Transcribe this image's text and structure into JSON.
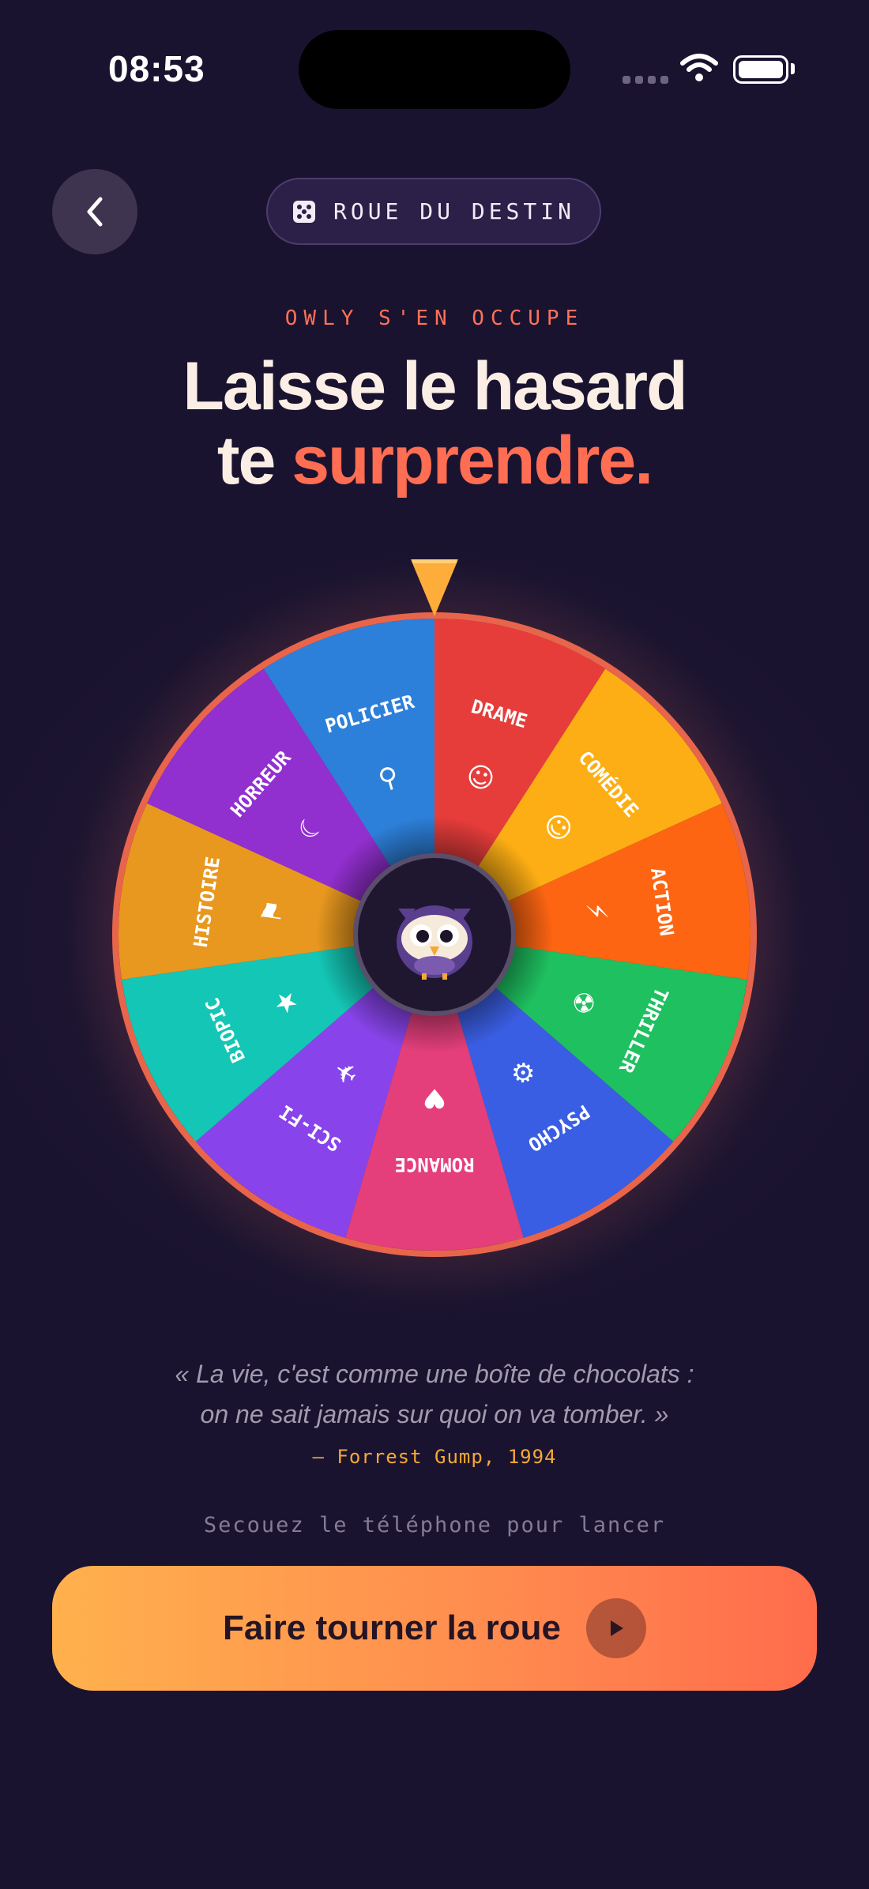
{
  "status": {
    "time": "08:53"
  },
  "header": {
    "badge_label": "ROUE DU DESTIN"
  },
  "hero": {
    "eyebrow": "OWLY S'EN OCCUPE",
    "title_line1": "Laisse le hasard",
    "title_line2_plain": "te ",
    "title_line2_accent": "surprendre."
  },
  "wheel": {
    "pointer_color": "#ffad3a",
    "rim_color": "#e8654c",
    "segments": [
      {
        "label": "DRAME",
        "color": "#e63d3b",
        "icon": "drama-masks-icon"
      },
      {
        "label": "COMÉDIE",
        "color": "#fdae14",
        "icon": "smiley-icon"
      },
      {
        "label": "ACTION",
        "color": "#fd6512",
        "icon": "lightning-icon"
      },
      {
        "label": "THRILLER",
        "color": "#1ec060",
        "icon": "radioactive-icon"
      },
      {
        "label": "PSYCHO",
        "color": "#3a5ee3",
        "icon": "brain-chip-icon"
      },
      {
        "label": "ROMANCE",
        "color": "#e43f7b",
        "icon": "heart-icon"
      },
      {
        "label": "SCI-FI",
        "color": "#8844ea",
        "icon": "rocket-icon"
      },
      {
        "label": "BIOPIC",
        "color": "#14c6b5",
        "icon": "star-frame-icon"
      },
      {
        "label": "HISTOIRE",
        "color": "#e8981f",
        "icon": "scroll-map-icon"
      },
      {
        "label": "HORREUR",
        "color": "#922fcf",
        "icon": "moon-icon"
      },
      {
        "label": "POLICIER",
        "color": "#2d80da",
        "icon": "magnifier-icon"
      }
    ],
    "center_icon": "owl-mascot-icon"
  },
  "quote": {
    "line1": "« La vie, c'est comme une boîte de chocolats :",
    "line2": "on ne sait jamais sur quoi on va tomber. »",
    "author": "— Forrest Gump, 1994"
  },
  "hint": "Secouez le téléphone pour lancer",
  "cta": {
    "label": "Faire tourner la roue"
  }
}
